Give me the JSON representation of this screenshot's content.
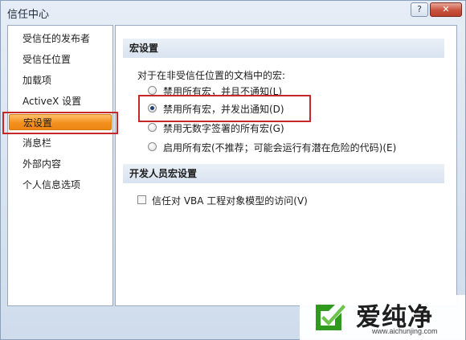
{
  "window": {
    "title": "信任中心",
    "help_label": "?",
    "close_label": "✕"
  },
  "sidebar": {
    "items": [
      {
        "label": "受信任的发布者",
        "selected": false
      },
      {
        "label": "受信任位置",
        "selected": false
      },
      {
        "label": "加载项",
        "selected": false
      },
      {
        "label": "ActiveX 设置",
        "selected": false
      },
      {
        "label": "宏设置",
        "selected": true
      },
      {
        "label": "消息栏",
        "selected": false
      },
      {
        "label": "外部内容",
        "selected": false
      },
      {
        "label": "个人信息选项",
        "selected": false
      }
    ]
  },
  "macro_settings": {
    "header": "宏设置",
    "description": "对于在非受信任位置的文档中的宏:",
    "options": [
      {
        "label": "禁用所有宏，并且不通知(L)",
        "checked": false
      },
      {
        "label": "禁用所有宏，并发出通知(D)",
        "checked": true
      },
      {
        "label": "禁用无数字签署的所有宏(G)",
        "checked": false
      },
      {
        "label": "启用所有宏(不推荐；可能会运行有潜在危险的代码)(E)",
        "checked": false
      }
    ]
  },
  "developer_settings": {
    "header": "开发人员宏设置",
    "checkbox_label": "信任对 VBA 工程对象模型的访问(V)",
    "checked": false
  },
  "watermark": {
    "brand": "爱纯净",
    "url": "www.aichunjing.com",
    "color": "#2f9a1e"
  }
}
